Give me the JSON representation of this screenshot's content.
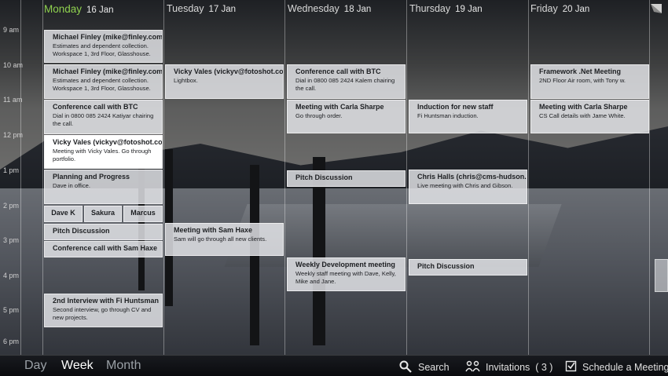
{
  "days": [
    {
      "name": "Monday",
      "date": "16 Jan"
    },
    {
      "name": "Tuesday",
      "date": "17 Jan"
    },
    {
      "name": "Wednesday",
      "date": "18 Jan"
    },
    {
      "name": "Thursday",
      "date": "19 Jan"
    },
    {
      "name": "Friday",
      "date": "20 Jan"
    }
  ],
  "hours": [
    "9 am",
    "10 am",
    "11 am",
    "12 pm",
    "1 pm",
    "2 pm",
    "3 pm",
    "4 pm",
    "5 pm",
    "6 pm"
  ],
  "events": {
    "mon": [
      {
        "title": "Michael Finley (mike@finley.com)",
        "desc": "Estimates and dependent collection. Workspace 1, 3rd Floor, Glasshouse."
      },
      {
        "title": "Michael Finley (mike@finley.com)",
        "desc": "Estimates and dependent collection. Workspace 1, 3rd Floor, Glasshouse."
      },
      {
        "title": "Conference call with BTC",
        "desc": "Dial in 0800 085 2424 Katiyar chairing the call."
      },
      {
        "title": "Vicky Vales (vickyv@fotoshot.com)",
        "desc": "Meeting with Vicky Vales. Go through portfolio."
      },
      {
        "title": "Planning and Progress",
        "desc": "Dave in office."
      },
      {
        "title": "Dave K",
        "desc": ""
      },
      {
        "title": "Sakura",
        "desc": ""
      },
      {
        "title": "Marcus",
        "desc": ""
      },
      {
        "title": "Pitch Discussion",
        "desc": ""
      },
      {
        "title": "Conference call with Sam Haxe",
        "desc": ""
      },
      {
        "title": "2nd Interview with Fi Huntsman",
        "desc": "Second interview, go through CV and new projects."
      }
    ],
    "tue": [
      {
        "title": "Vicky Vales (vickyv@fotoshot.com)",
        "desc": "Lightbox."
      },
      {
        "title": "Meeting with Sam Haxe",
        "desc": "Sam will go through all new clients."
      }
    ],
    "wed": [
      {
        "title": "Conference call with BTC",
        "desc": "Dial in 0800 085 2424 Kalem chairing the call."
      },
      {
        "title": "Meeting with Carla Sharpe",
        "desc": "Go through order."
      },
      {
        "title": "Pitch Discussion",
        "desc": ""
      },
      {
        "title": "Weekly Development meeting",
        "desc": "Weekly staff meeting with Dave, Kelly, Mike and Jane."
      }
    ],
    "thu": [
      {
        "title": "Induction for new staff",
        "desc": "Fi Huntsman induction."
      },
      {
        "title": "Chris Halls (chris@cms-hudson.com)",
        "desc": "Live meeting with Chris and Gibson."
      },
      {
        "title": "Pitch Discussion",
        "desc": ""
      }
    ],
    "fri": [
      {
        "title": "Framework .Net Meeting",
        "desc": "2ND Floor Air room, with Tony w."
      },
      {
        "title": "Meeting with Carla Sharpe",
        "desc": "CS Call details with Jame White."
      }
    ]
  },
  "views": [
    "Day",
    "Week",
    "Month"
  ],
  "selected_view": "Week",
  "toolbar": {
    "search_label": "Search",
    "invitations_label": "Invitations",
    "invitations_count": "( 3 )",
    "schedule_label": "Schedule a Meeting"
  },
  "colors": {
    "today": "#8fd14f",
    "event_bg": "#e6e8eb",
    "event_active": "#ffffff"
  }
}
